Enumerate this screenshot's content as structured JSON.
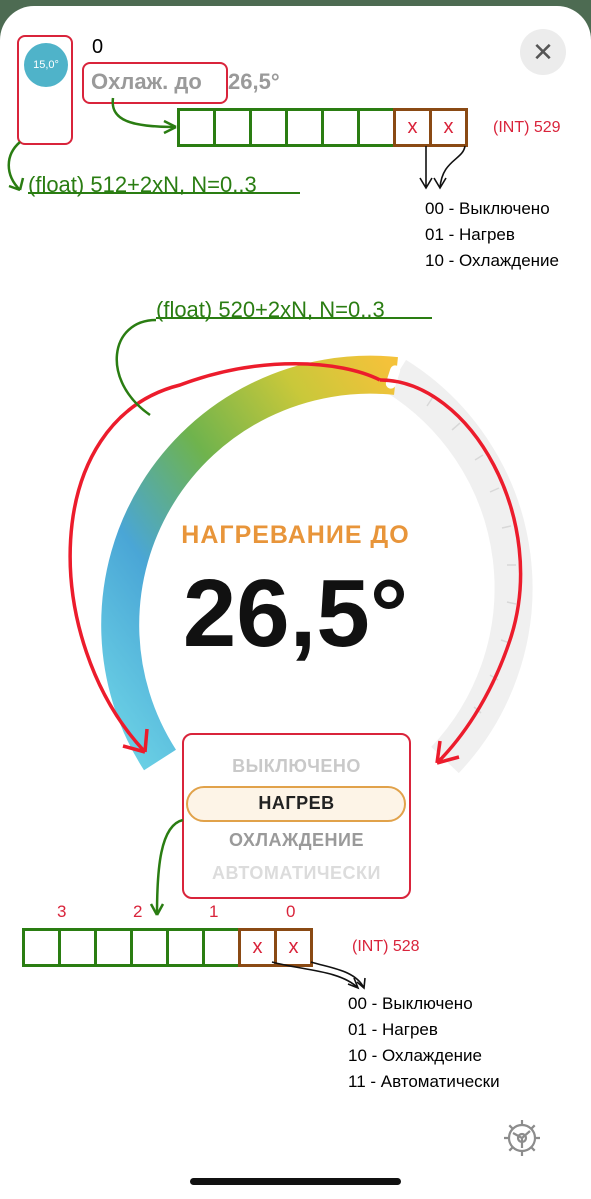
{
  "header": {
    "avatar_value": "15,0°",
    "zero_label": "0",
    "cooling_label": "Охлаж. до",
    "cooling_value": "26,5°"
  },
  "register_top": {
    "cells": [
      "",
      "",
      "",
      "",
      "",
      "",
      "x",
      "x"
    ],
    "label": "(INT) 529"
  },
  "annotation_float_top": "(float) 512+2xN, N=0..3",
  "legend_top": [
    "00 - Выключено",
    "01 - Нагрев",
    "10 - Охлаждение"
  ],
  "annotation_float_dial": "(float) 520+2xN, N=0..3",
  "dial": {
    "title": "НАГРЕВАНИЕ ДО",
    "temperature": "26,5°"
  },
  "modes": {
    "off": "ВЫКЛЮЧЕНО",
    "heat": "НАГРЕВ",
    "cool": "ОХЛАЖДЕНИЕ",
    "auto": "АВТОМАТИЧЕСКИ"
  },
  "register_bottom": {
    "bit_numbers": [
      "3",
      "2",
      "1",
      "0"
    ],
    "cells": [
      "",
      "",
      "",
      "",
      "",
      "",
      "x",
      "x"
    ],
    "label": "(INT) 528"
  },
  "legend_bottom": [
    "00 - Выключено",
    "01 - Нагрев",
    "10 - Охлаждение",
    "11 - Автоматически"
  ],
  "icons": {
    "close": "close-icon",
    "settings": "gear-icon"
  },
  "colors": {
    "annotation_red": "#d9243b",
    "annotation_green": "#2a7d12",
    "heat_orange": "#e8953a",
    "avatar_blue": "#4fb3c9"
  }
}
